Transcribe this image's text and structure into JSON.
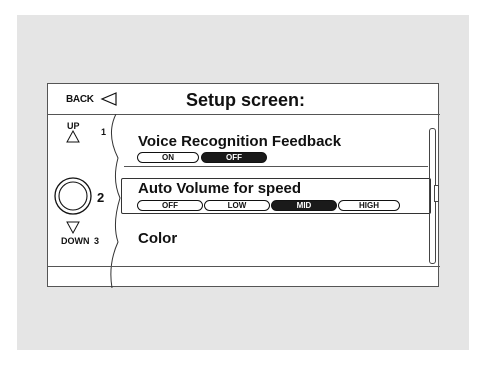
{
  "header": {
    "back_label": "BACK",
    "title": "Setup screen:"
  },
  "controller": {
    "up_label": "UP",
    "down_label": "DOWN",
    "num1": "1",
    "num2": "2",
    "num3": "3"
  },
  "rows": [
    {
      "label": "Voice Recognition Feedback",
      "options": [
        "ON",
        "OFF"
      ],
      "selected": "OFF"
    },
    {
      "label": "Auto Volume for speed",
      "options": [
        "OFF",
        "LOW",
        "MID",
        "HIGH"
      ],
      "selected": "MID"
    },
    {
      "label": "Color"
    }
  ],
  "colors": {
    "selected_fill": "#1a1a1a",
    "panel_bg": "#e5e5e5"
  }
}
